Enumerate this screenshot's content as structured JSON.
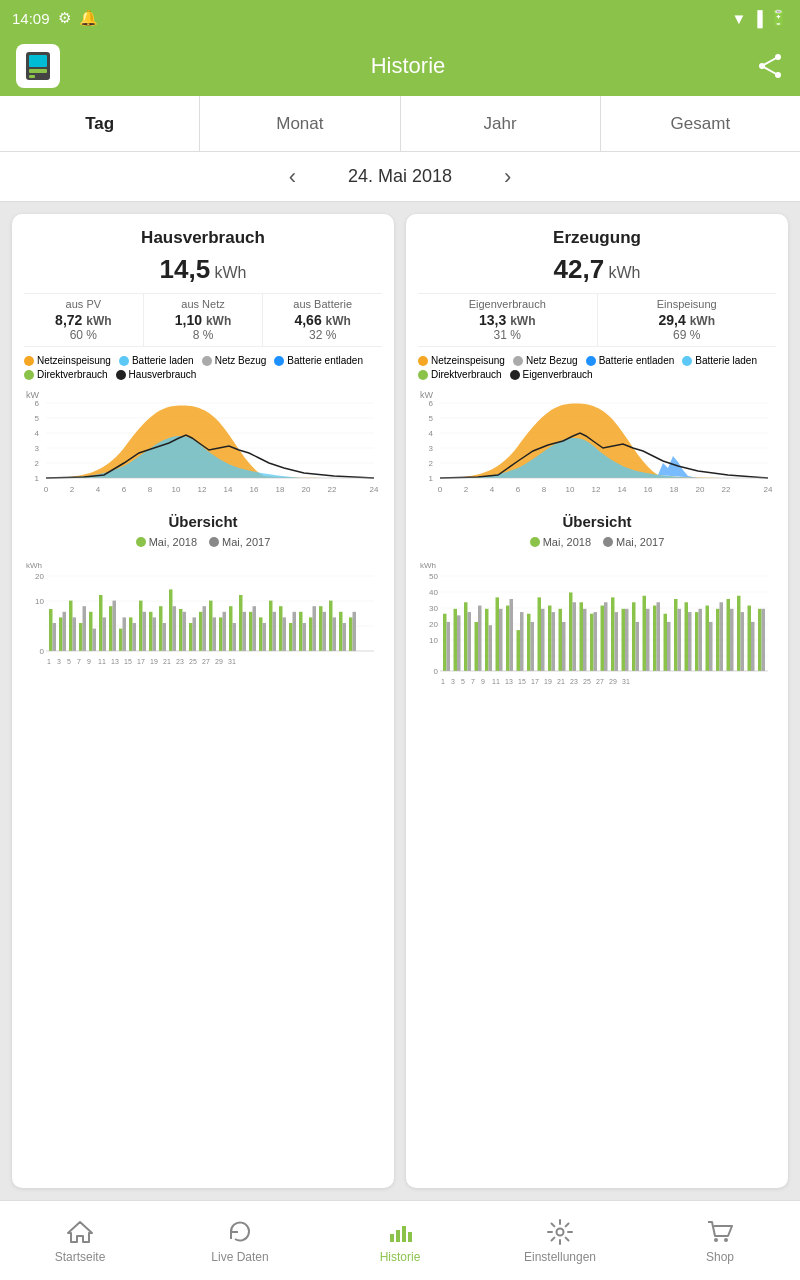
{
  "statusBar": {
    "time": "14:09",
    "icons": [
      "settings-icon",
      "notification-icon",
      "wifi-icon",
      "signal-icon",
      "battery-icon"
    ]
  },
  "appBar": {
    "title": "Historie",
    "shareLabel": "share"
  },
  "tabs": [
    {
      "id": "tag",
      "label": "Tag",
      "active": true
    },
    {
      "id": "monat",
      "label": "Monat",
      "active": false
    },
    {
      "id": "jahr",
      "label": "Jahr",
      "active": false
    },
    {
      "id": "gesamt",
      "label": "Gesamt",
      "active": false
    }
  ],
  "dateNav": {
    "date": "24. Mai 2018",
    "prevLabel": "‹",
    "nextLabel": "›"
  },
  "cards": {
    "left": {
      "title": "Hausverbrauch",
      "total": "14,5",
      "unit": "kWh",
      "subCols": [
        {
          "label": "aus PV",
          "value": "8,72",
          "unit": "kWh",
          "pct": "60 %"
        },
        {
          "label": "aus Netz",
          "value": "1,10",
          "unit": "kWh",
          "pct": "8 %"
        },
        {
          "label": "aus Batterie",
          "value": "4,66",
          "unit": "kWh",
          "pct": "32 %"
        }
      ],
      "legend": [
        {
          "color": "#f5a623",
          "label": "Netzeinspeisung"
        },
        {
          "color": "#5bc8f5",
          "label": "Batterie laden"
        },
        {
          "color": "#aaa",
          "label": "Netz Bezug"
        },
        {
          "color": "#1e90ff",
          "label": "Batterie entladen"
        },
        {
          "color": "#8bc34a",
          "label": "Direktverbrauch"
        },
        {
          "color": "#222",
          "label": "Hausverbrauch"
        }
      ],
      "chartYLabel": "kW",
      "overviewTitle": "Übersicht",
      "overviewLegend": [
        {
          "color": "#8bc34a",
          "label": "Mai, 2018"
        },
        {
          "color": "#888",
          "label": "Mai, 2017"
        }
      ]
    },
    "right": {
      "title": "Erzeugung",
      "total": "42,7",
      "unit": "kWh",
      "subCols": [
        {
          "label": "Eigenverbrauch",
          "value": "13,3",
          "unit": "kWh",
          "pct": "31 %"
        },
        {
          "label": "Einspeisung",
          "value": "29,4",
          "unit": "kWh",
          "pct": "69 %"
        }
      ],
      "legend": [
        {
          "color": "#f5a623",
          "label": "Netzeinspeisung"
        },
        {
          "color": "#aaa",
          "label": "Netz Bezug"
        },
        {
          "color": "#1e90ff",
          "label": "Batterie entladen"
        },
        {
          "color": "#5bc8f5",
          "label": "Batterie laden"
        },
        {
          "color": "#8bc34a",
          "label": "Direktverbrauch"
        },
        {
          "color": "#222",
          "label": "Eigenverbrauch"
        }
      ],
      "chartYLabel": "kW",
      "overviewTitle": "Übersicht",
      "overviewLegend": [
        {
          "color": "#8bc34a",
          "label": "Mai, 2018"
        },
        {
          "color": "#888",
          "label": "Mai, 2017"
        }
      ]
    }
  },
  "bottomNav": {
    "items": [
      {
        "id": "startseite",
        "label": "Startseite",
        "active": false,
        "icon": "home-icon"
      },
      {
        "id": "live-daten",
        "label": "Live Daten",
        "active": false,
        "icon": "refresh-icon"
      },
      {
        "id": "historie",
        "label": "Historie",
        "active": true,
        "icon": "bar-chart-icon"
      },
      {
        "id": "einstellungen",
        "label": "Einstellungen",
        "active": false,
        "icon": "settings-icon"
      },
      {
        "id": "shop",
        "label": "Shop",
        "active": false,
        "icon": "cart-icon"
      }
    ]
  }
}
